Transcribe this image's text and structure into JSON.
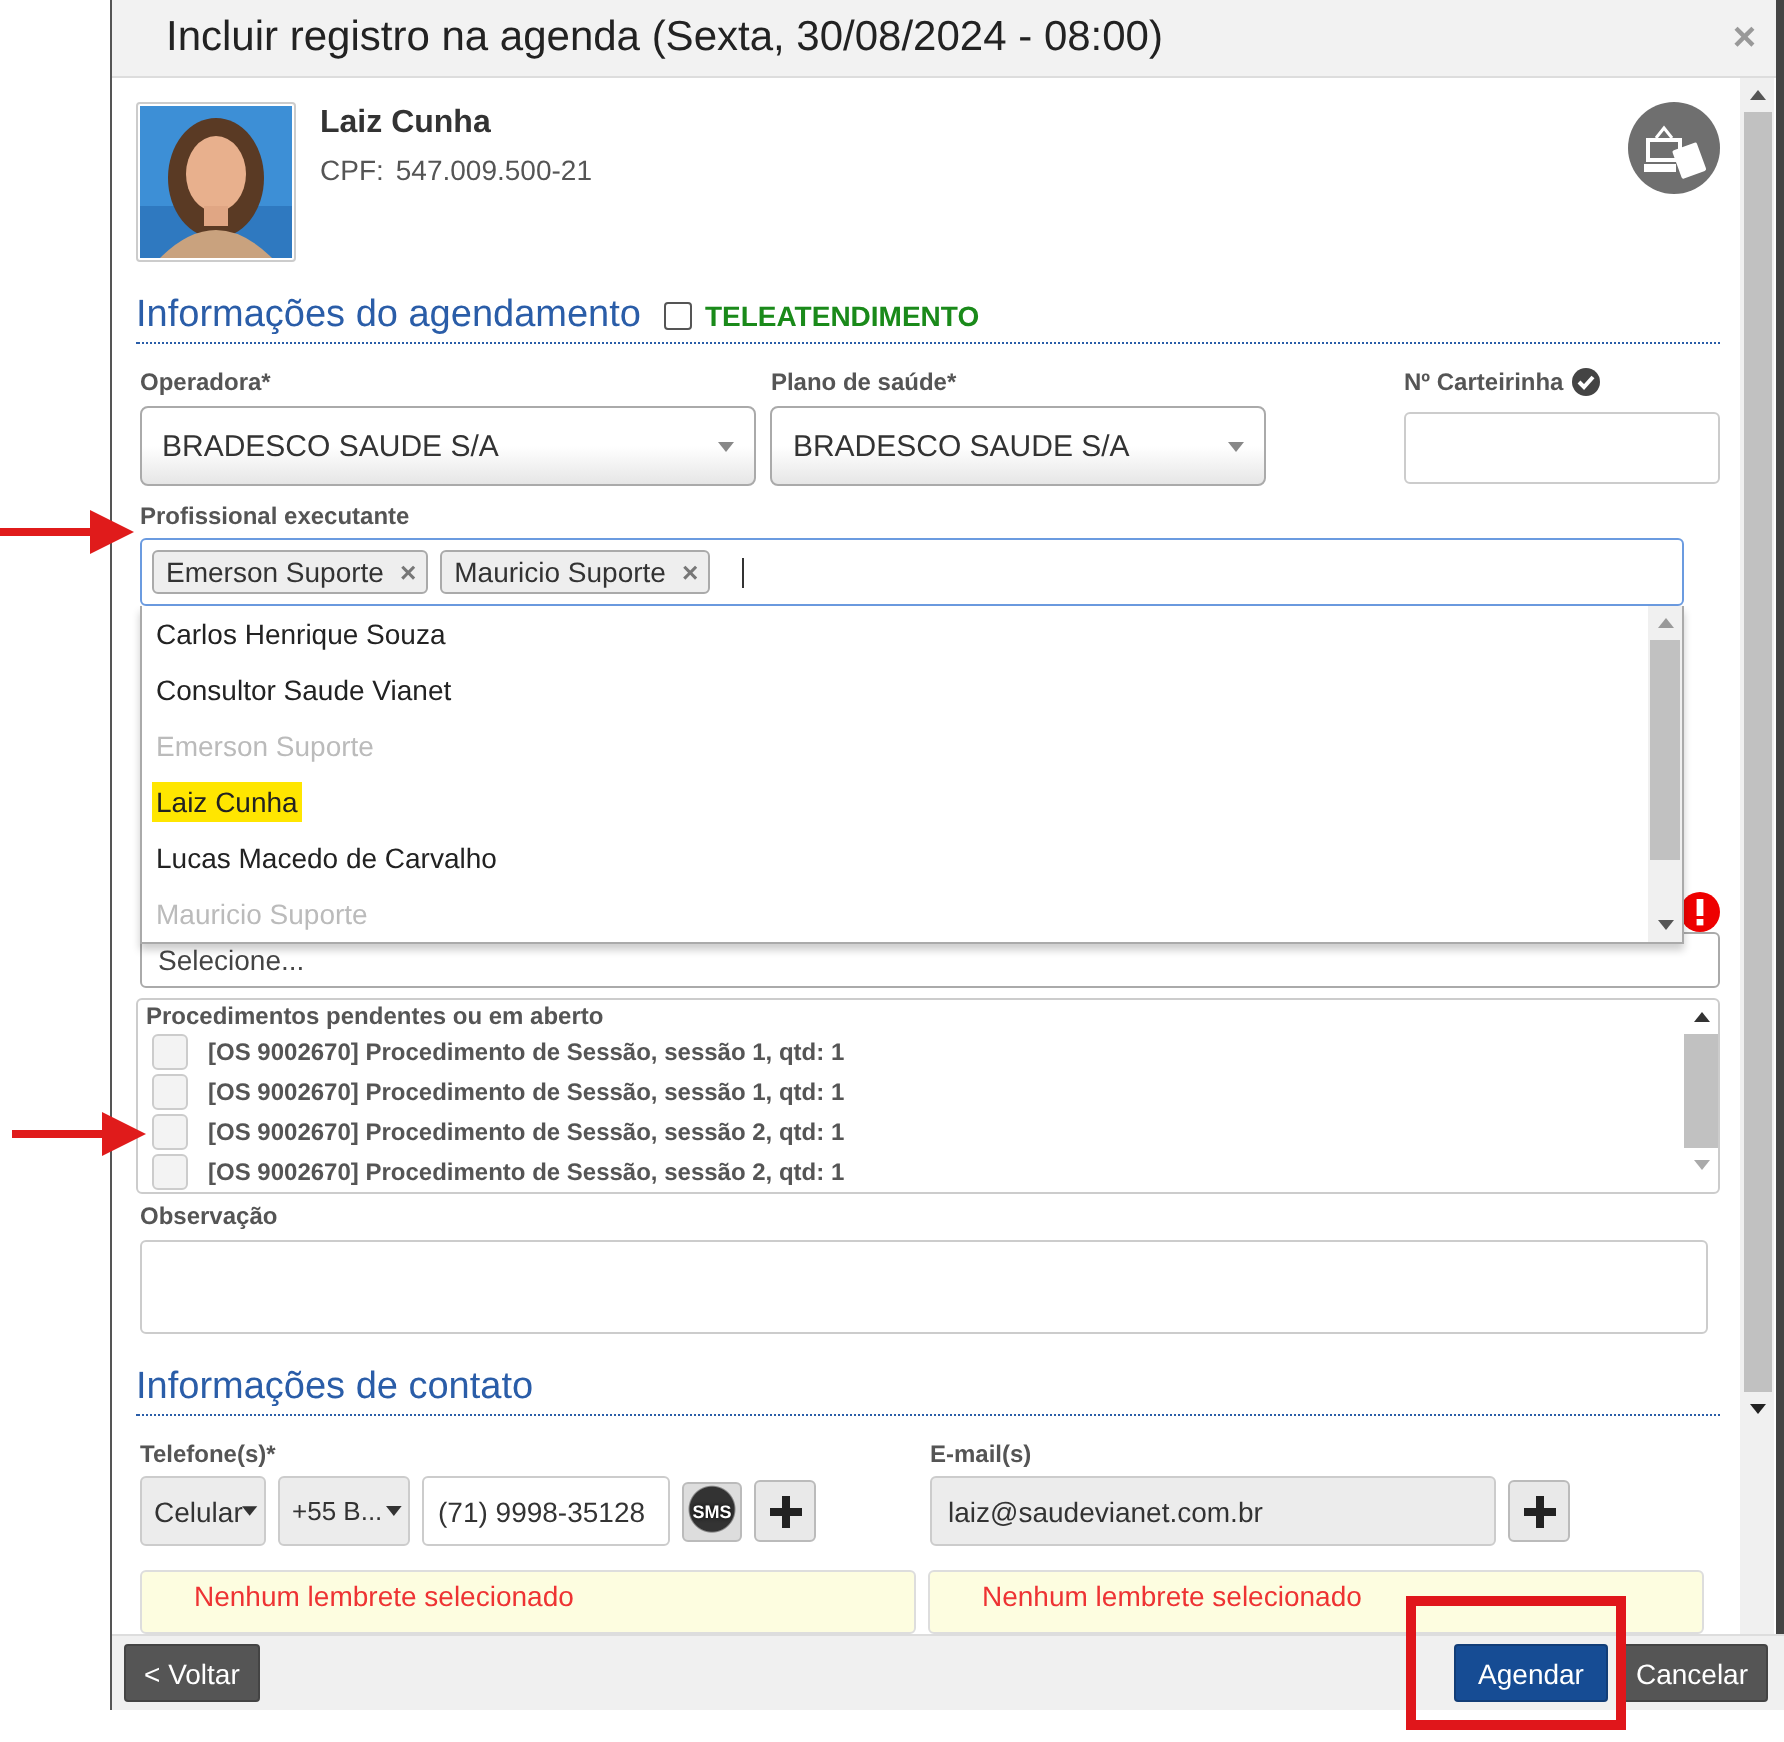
{
  "dialog": {
    "title": "Incluir registro na agenda (Sexta, 30/08/2024 - 08:00)",
    "close": "×"
  },
  "patient": {
    "name": "Laiz Cunha",
    "cpf_label": "CPF:",
    "cpf": "547.009.500-21"
  },
  "scheduling": {
    "heading": "Informações do agendamento",
    "telehealth": {
      "label": "TELEATENDIMENTO",
      "checked": false
    }
  },
  "operadora": {
    "label": "Operadora*",
    "value": "BRADESCO SAUDE S/A"
  },
  "plano": {
    "label": "Plano de saúde*",
    "value": "BRADESCO SAUDE S/A"
  },
  "carteirinha": {
    "label": "Nº Carteirinha"
  },
  "professional": {
    "label": "Profissional executante",
    "tags": [
      {
        "label": "Emerson Suporte",
        "remove": "×"
      },
      {
        "label": "Mauricio Suporte",
        "remove": "×"
      }
    ],
    "options": [
      {
        "label": "Carlos Henrique Souza",
        "disabled": false,
        "selected": false
      },
      {
        "label": "Consultor Saude Vianet",
        "disabled": false,
        "selected": false
      },
      {
        "label": "Emerson Suporte",
        "disabled": true,
        "selected": false
      },
      {
        "label": "Laiz Cunha",
        "disabled": false,
        "selected": true
      },
      {
        "label": "Lucas Macedo de Carvalho",
        "disabled": false,
        "selected": false
      },
      {
        "label": "Mauricio Suporte",
        "disabled": true,
        "selected": false
      }
    ]
  },
  "select_placeholder": "Selecione...",
  "procedures": {
    "label": "Procedimentos pendentes ou em aberto",
    "items": [
      {
        "text": "[OS 9002670] Procedimento de Sessão, sessão 1, qtd: 1",
        "checked": false
      },
      {
        "text": "[OS 9002670] Procedimento de Sessão, sessão 1, qtd: 1",
        "checked": false
      },
      {
        "text": "[OS 9002670] Procedimento de Sessão, sessão 2, qtd: 1",
        "checked": false
      },
      {
        "text": "[OS 9002670] Procedimento de Sessão, sessão 2, qtd: 1",
        "checked": false
      }
    ]
  },
  "observacao": {
    "label": "Observação"
  },
  "contact": {
    "heading": "Informações de contato",
    "phone_label": "Telefone(s)*",
    "phone_type": "Celular",
    "country": "+55 B...",
    "phone": "(71) 9998-35128",
    "sms": "SMS",
    "email_label": "E-mail(s)",
    "email": "laiz@saudevianet.com.br"
  },
  "reminders": [
    "Nenhum lembrete selecionado",
    "Nenhum lembrete selecionado"
  ],
  "footer": {
    "back": "< Voltar",
    "schedule": "Agendar",
    "cancel": "Cancelar"
  }
}
